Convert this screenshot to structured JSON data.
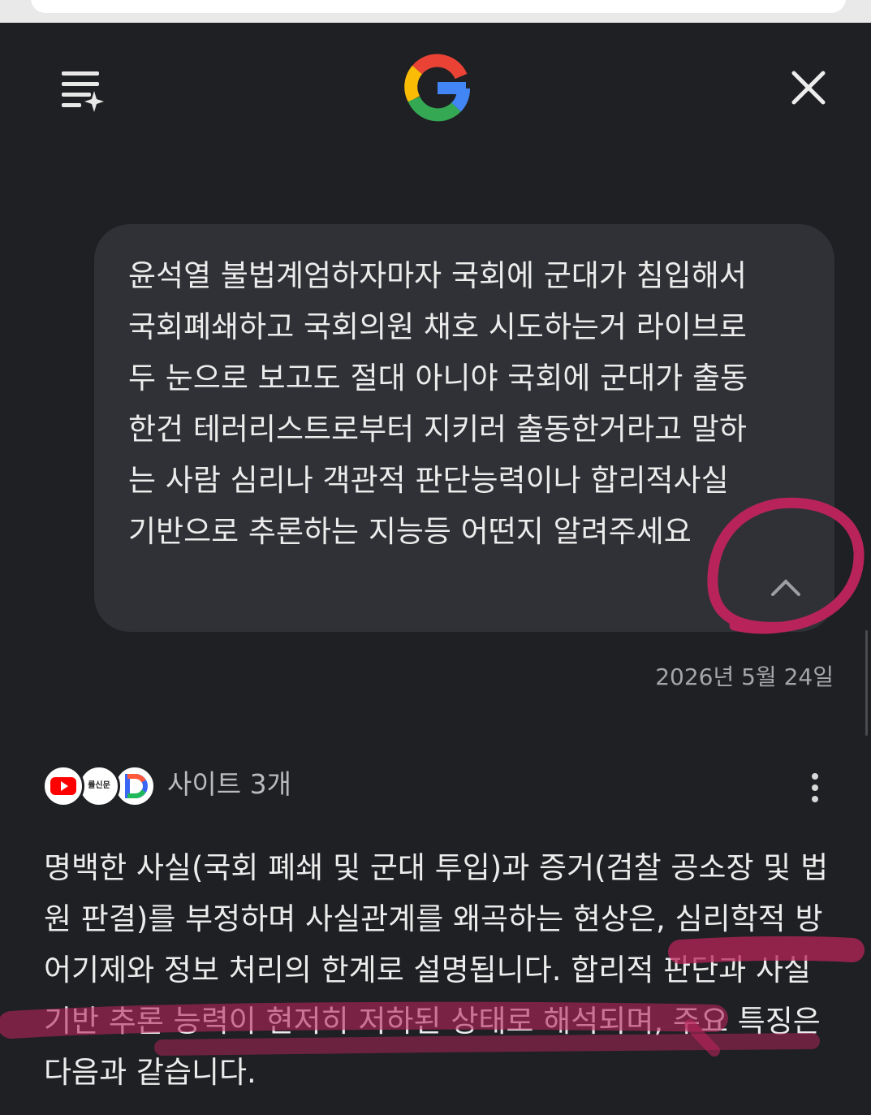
{
  "header": {
    "menu_icon": "history-sparkle-icon",
    "logo_icon": "google-g-logo",
    "close_icon": "close-icon"
  },
  "user_message": {
    "text": "윤석열 불법계엄하자마자 국회에 군대가 침입해서 국회폐쇄하고 국회의원 채호 시도하는거 라이브로 두 눈으로 보고도 절대 아니야 국회에 군대가 출동한건 테러리스트로부터 지키러 출동한거라고 말하는 사람 심리나 객관적 판단능력이나 합리적사실 기반으로 추론하는 지능등 어떤지 알려주세요",
    "collapse_icon": "chevron-up-icon",
    "date": "2026년 5월 24일"
  },
  "sources": {
    "icons": [
      "youtube-icon",
      "newspaper-icon",
      "daum-icon"
    ],
    "news_icon_text": "률신문",
    "count_label": "사이트 3개",
    "more_icon": "more-vertical-icon"
  },
  "answer": {
    "text": "명백한 사실(국회 폐쇄 및 군대 투입)과 증거(검찰 공소장 및 법원 판결)를 부정하며 사실관계를 왜곡하는 현상은, 심리학적 방어기제와 정보 처리의 한계로 설명됩니다. 합리적 판단과 사실 기반 추론 능력이 현저히 저하된 상태로 해석되며, 주요 특징은 다음과 같습니다."
  },
  "colors": {
    "background": "#1f2023",
    "bubble": "#303136",
    "annotation": "#b8245a"
  }
}
